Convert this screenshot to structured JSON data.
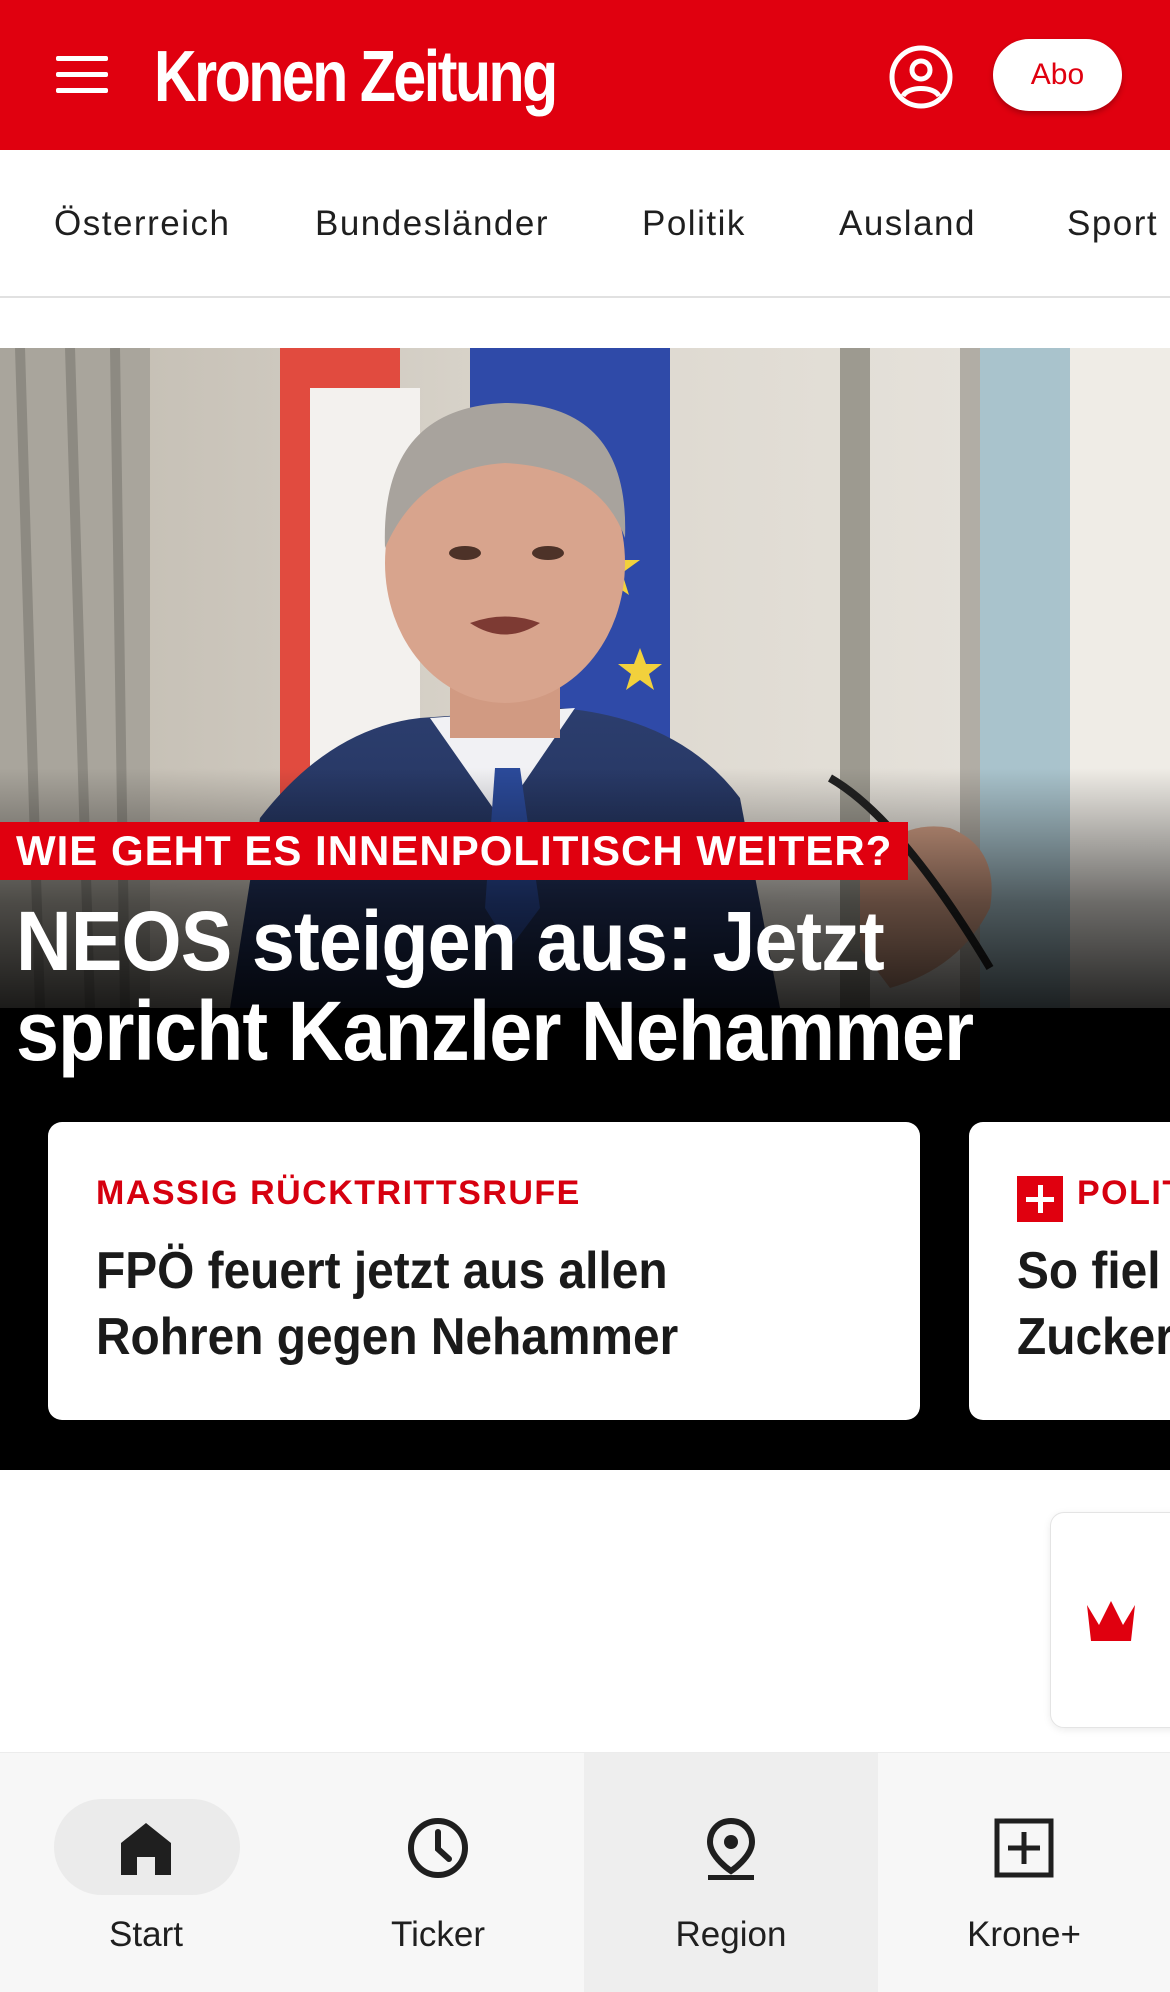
{
  "header": {
    "logo_text": "Kronen Zeitung",
    "abo_label": "Abo",
    "brand_color": "#e0000f",
    "menu_icon": "hamburger-menu-icon",
    "account_icon": "user-account-icon"
  },
  "categories": [
    "Österreich",
    "Bundesländer",
    "Politik",
    "Ausland",
    "Sport"
  ],
  "hero": {
    "kicker": "WIE GEHT ES INNENPOLITISCH WEITER?",
    "headline": "NEOS steigen aus: Jetzt spricht Kanzler Nehammer"
  },
  "cards": [
    {
      "kicker": "MASSIG RÜCKTRITTSRUFE",
      "title_line1": "FPÖ feuert jetzt aus allen",
      "title_line2": "Rohren gegen Nehammer"
    },
    {
      "kicker": "POLIT",
      "title_line1": "So fiel",
      "title_line2": "Zucker"
    }
  ],
  "floating_widget": {
    "icon": "crown-icon"
  },
  "bottom_nav": [
    {
      "label": "Start",
      "icon": "home-icon"
    },
    {
      "label": "Ticker",
      "icon": "clock-icon"
    },
    {
      "label": "Region",
      "icon": "location-pin-icon"
    },
    {
      "label": "Krone+",
      "icon": "plus-box-icon"
    }
  ]
}
